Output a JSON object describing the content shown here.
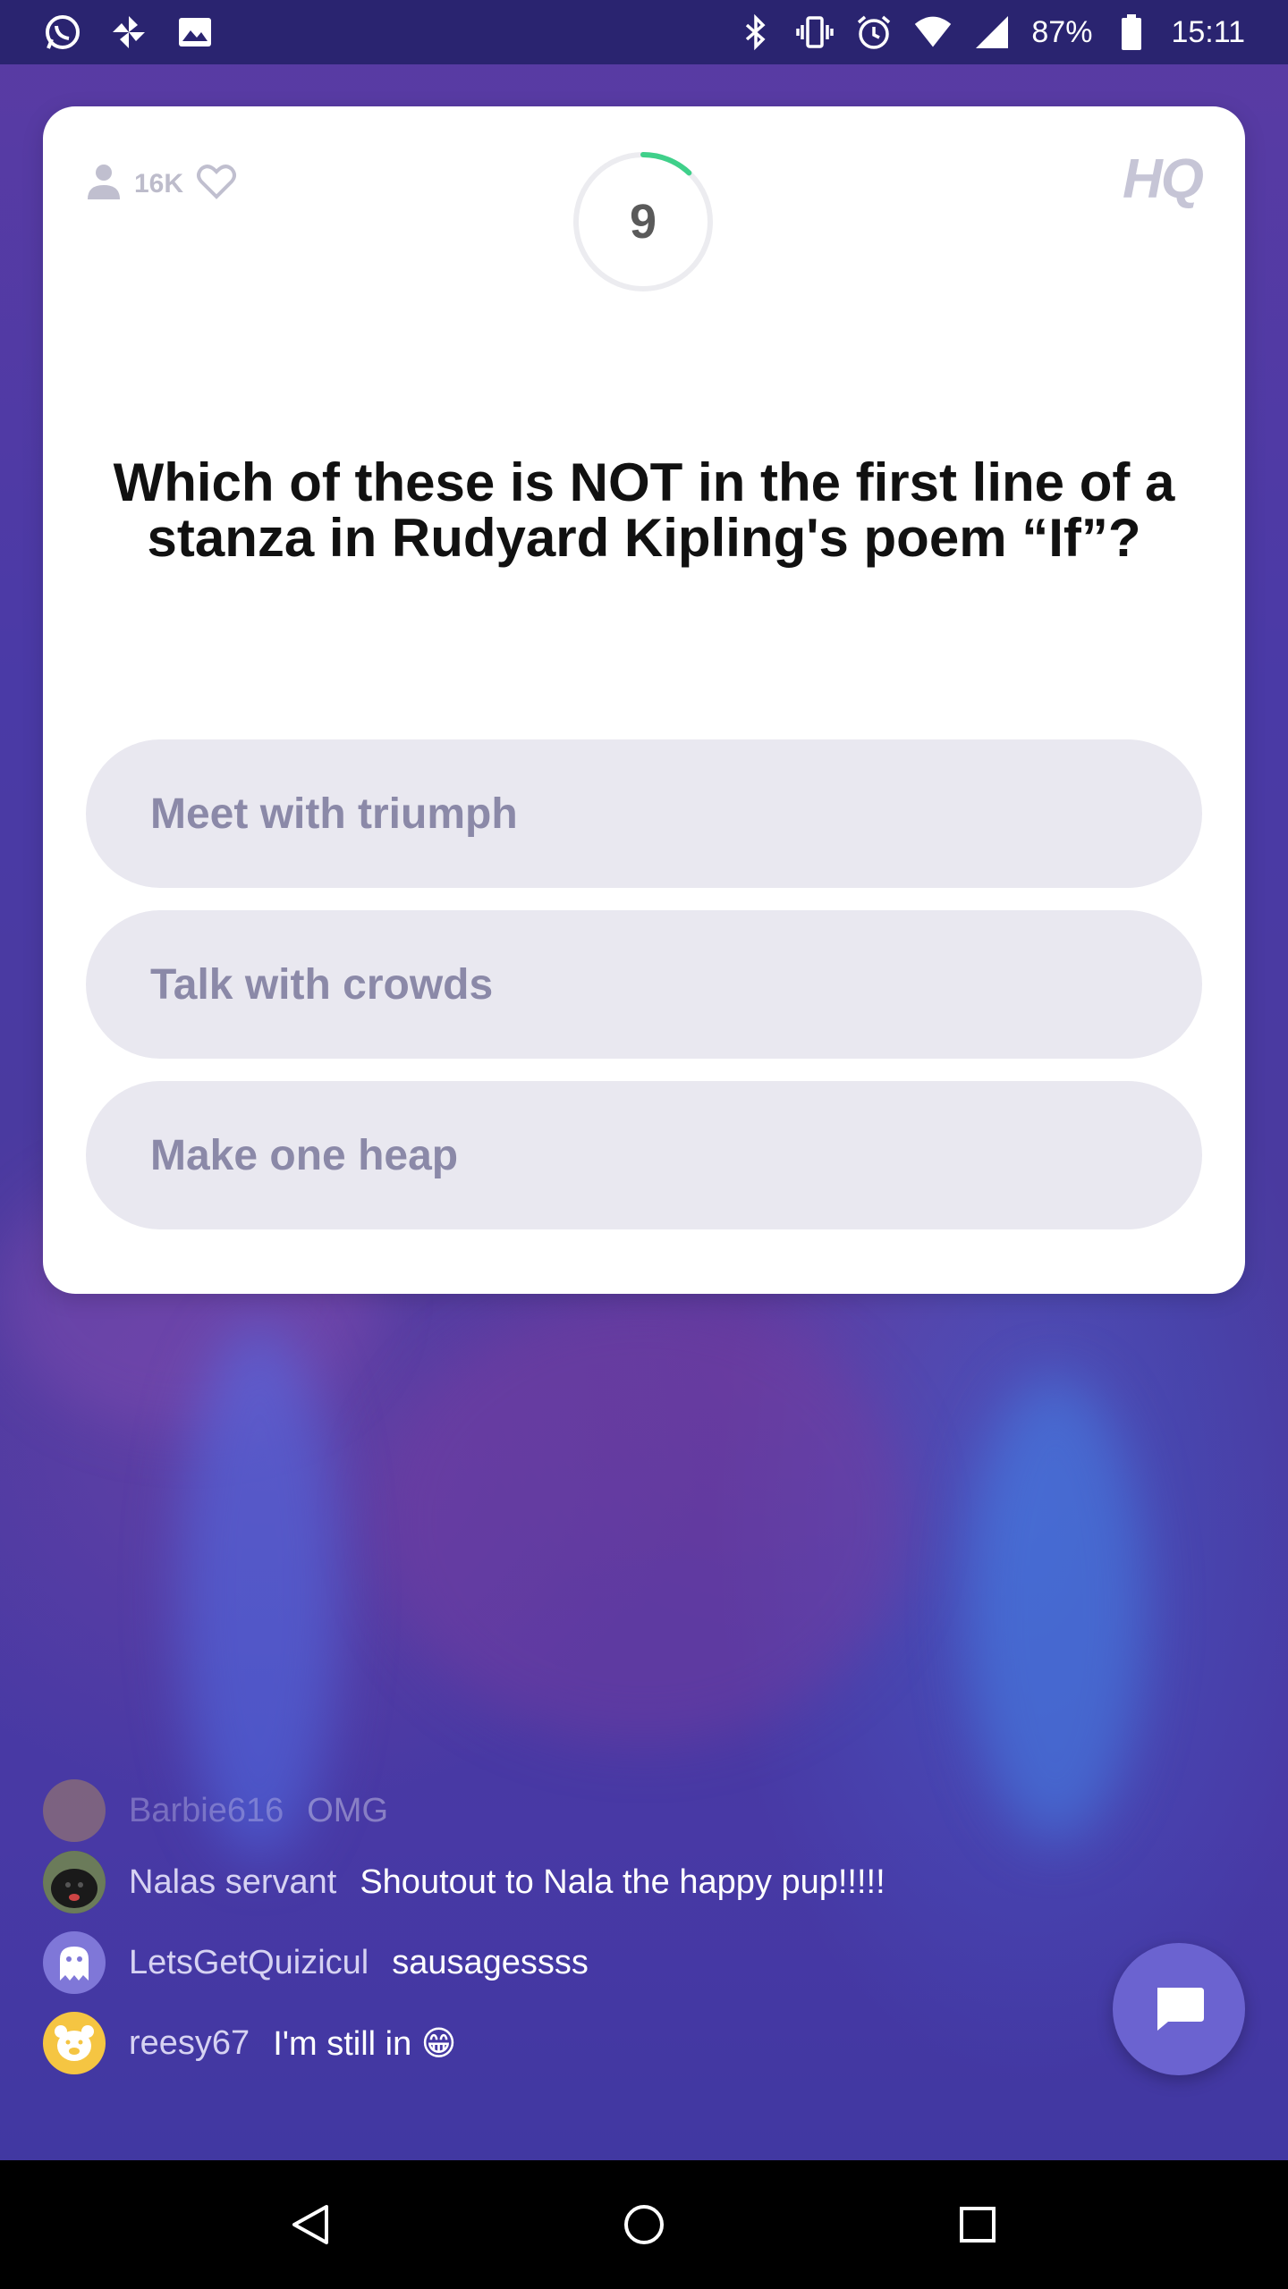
{
  "status_bar": {
    "battery_percent": "87%",
    "time": "15:11",
    "left_icons": [
      "whatsapp-icon",
      "pinwheel-icon",
      "gallery-icon"
    ],
    "right_icons": [
      "bluetooth-icon",
      "vibrate-icon",
      "alarm-icon",
      "wifi-icon",
      "signal-icon",
      "battery-icon"
    ]
  },
  "game": {
    "viewer_count": "16K",
    "timer_value": "9",
    "timer_fraction_remaining": 0.12,
    "logo": "HQ",
    "question": "Which of these is NOT in the first line of a stanza in Rudyard Kipling's poem “If”?",
    "answers": [
      {
        "label": "Meet with triumph"
      },
      {
        "label": "Talk with crowds"
      },
      {
        "label": "Make one heap"
      }
    ]
  },
  "chat": {
    "messages": [
      {
        "user": "Barbie616",
        "text": "OMG",
        "avatar": "avatar-yellow"
      },
      {
        "user": "Nalas servant",
        "text": "Shoutout to Nala the happy pup!!!!!",
        "avatar": "dog-photo-avatar"
      },
      {
        "user": "LetsGetQuizicul",
        "text": "sausagessss",
        "avatar": "ghost-icon"
      },
      {
        "user": "reesy67",
        "text": "I'm still in 😁",
        "avatar": "bear-icon"
      }
    ]
  },
  "colors": {
    "status_bar_bg": "#2a2470",
    "answer_bg": "#e9e8f0",
    "answer_text": "#8b89a8",
    "timer_arc": "#3fd08a",
    "chat_button": "#6b63d0"
  }
}
